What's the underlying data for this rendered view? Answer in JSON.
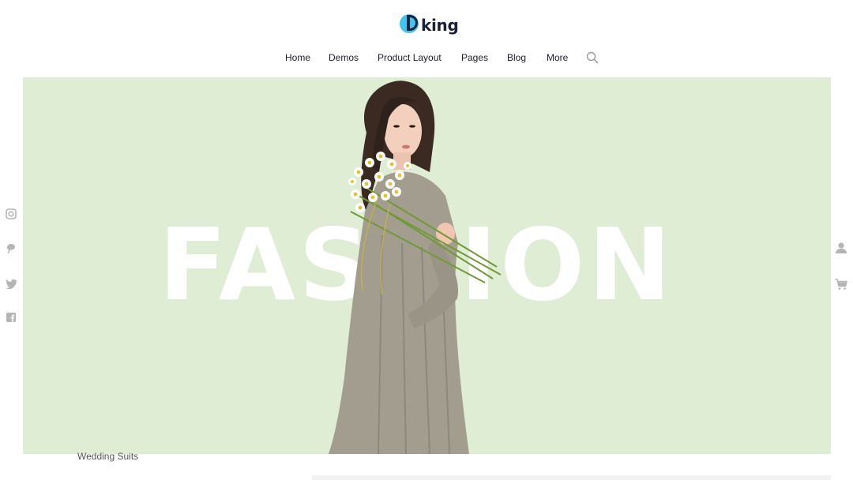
{
  "brand": {
    "logo_text": "king"
  },
  "nav": {
    "items": [
      "Home",
      "Demos",
      "Product Layout",
      "Pages",
      "Blog",
      "More"
    ],
    "search_icon": "search-icon"
  },
  "hero": {
    "headline": "FASHION",
    "background_color": "#deedd3",
    "image": "woman-holding-daisy-bouquet"
  },
  "social": [
    "instagram-icon",
    "pinterest-icon",
    "twitter-icon",
    "facebook-icon"
  ],
  "utility": [
    "user-icon",
    "cart-icon"
  ],
  "below_hero": {
    "caption": "Wedding Suits"
  }
}
